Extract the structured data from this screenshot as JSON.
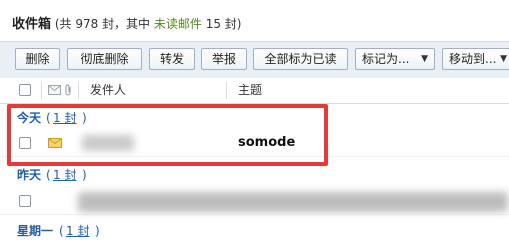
{
  "title": {
    "folder": "收件箱",
    "prefix": "(共 978 封，其中 ",
    "unread_link": "未读邮件",
    "suffix": " 15 封)"
  },
  "toolbar": {
    "delete": "删除",
    "purge": "彻底删除",
    "forward": "转发",
    "report": "举报",
    "mark_all_read": "全部标为已读",
    "mark_as": "标记为...",
    "move_to": "移动到..."
  },
  "columns": {
    "sender": "发件人",
    "subject": "主题"
  },
  "groups": [
    {
      "label": "今天",
      "count": "1 封"
    },
    {
      "label": "昨天",
      "count": "1 封"
    },
    {
      "label": "星期一",
      "count": "1 封"
    }
  ],
  "rows": [
    {
      "subject": "somode"
    },
    {
      "subject": ""
    }
  ],
  "colors": {
    "accent": "#1f5fa6",
    "unread_green": "#4e8a1f",
    "highlight_red": "#e23b3b",
    "toolbar_bg": "#e9eff5"
  }
}
